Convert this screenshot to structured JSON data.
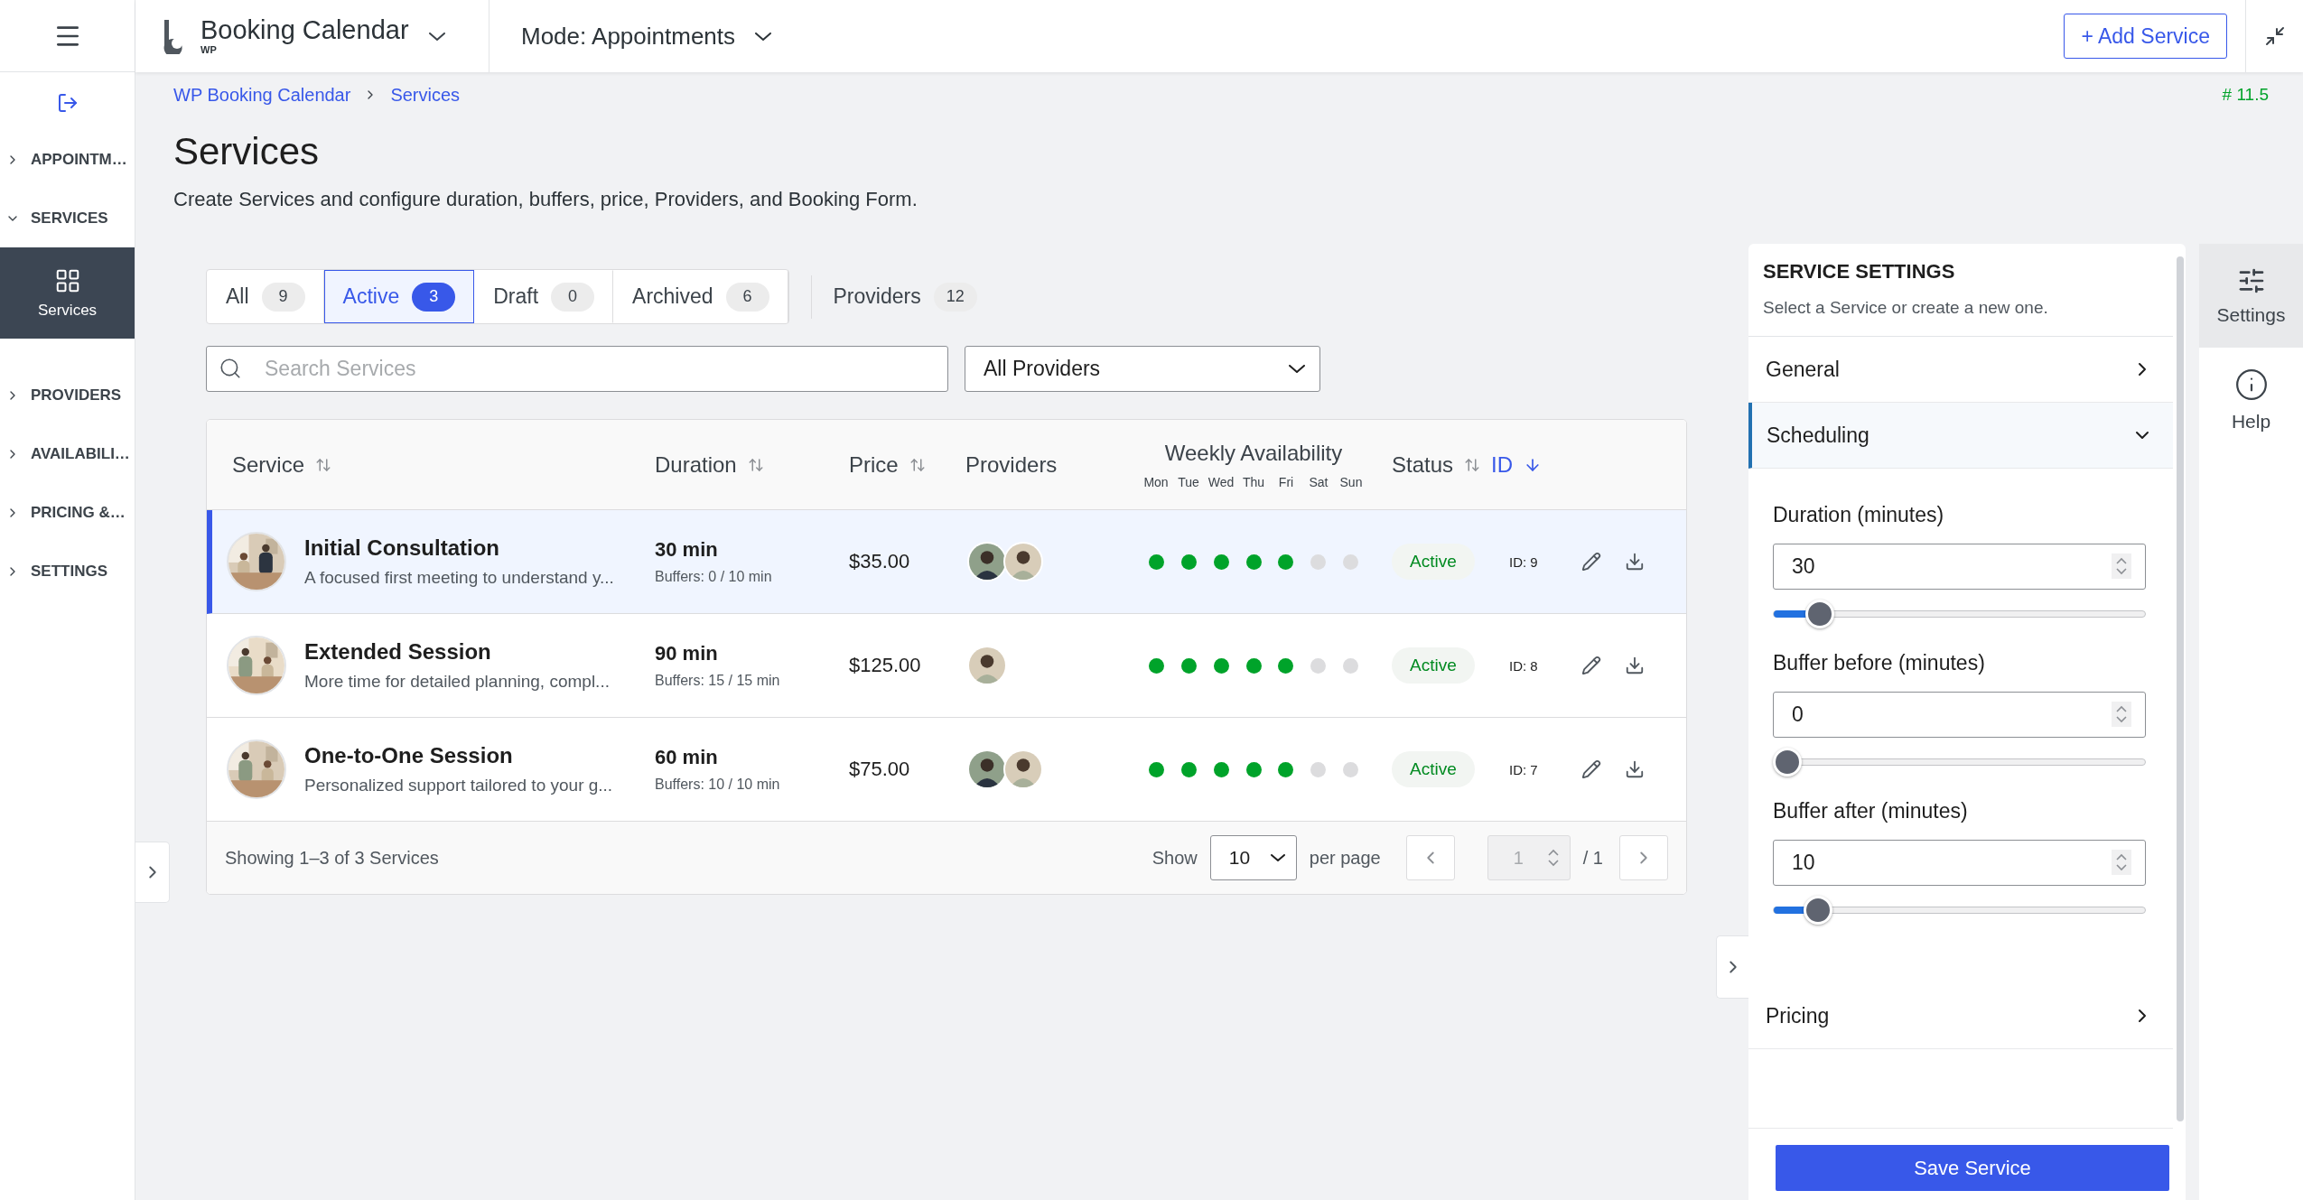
{
  "header": {
    "brand": "Booking Calendar",
    "brand_sub": "WP",
    "mode": "Mode: Appointments",
    "add_button": "+ Add Service"
  },
  "sidebar": {
    "items": [
      {
        "label": "APPOINTM…",
        "expanded": false
      },
      {
        "label": "SERVICES",
        "expanded": true,
        "children": [
          {
            "label": "Services",
            "selected": true
          }
        ]
      },
      {
        "label": "PROVIDERS",
        "expanded": false
      },
      {
        "label": "AVAILABILI…",
        "expanded": false
      },
      {
        "label": "PRICING &…",
        "expanded": false
      },
      {
        "label": "SETTINGS",
        "expanded": false
      }
    ]
  },
  "breadcrumb": [
    "WP Booking Calendar",
    "Services"
  ],
  "version": "# 11.5",
  "page": {
    "title": "Services",
    "subtitle": "Create Services and configure duration, buffers, price, Providers, and Booking Form."
  },
  "tabs": [
    {
      "label": "All",
      "count": "9",
      "selected": false
    },
    {
      "label": "Active",
      "count": "3",
      "selected": true
    },
    {
      "label": "Draft",
      "count": "0",
      "selected": false
    },
    {
      "label": "Archived",
      "count": "6",
      "selected": false
    }
  ],
  "providers_link": {
    "label": "Providers",
    "count": "12"
  },
  "search": {
    "placeholder": "Search Services"
  },
  "provider_filter": {
    "value": "All Providers"
  },
  "table": {
    "columns": [
      {
        "label": "Service",
        "sortable": true,
        "sorted": false
      },
      {
        "label": "Duration",
        "sortable": true,
        "sorted": false
      },
      {
        "label": "Price",
        "sortable": true,
        "sorted": false
      },
      {
        "label": "Providers",
        "sortable": false,
        "sorted": false
      },
      {
        "label": "Weekly Availability",
        "sortable": false,
        "sorted": false
      },
      {
        "label": "Status",
        "sortable": true,
        "sorted": false
      },
      {
        "label": "ID",
        "sortable": true,
        "sorted": true
      }
    ],
    "days": [
      "Mon",
      "Tue",
      "Wed",
      "Thu",
      "Fri",
      "Sat",
      "Sun"
    ],
    "rows": [
      {
        "selected": true,
        "name": "Initial Consultation",
        "description": "A focused first meeting to understand y...",
        "duration": "30 min",
        "buffers": "Buffers: 0 / 10 min",
        "price": "$35.00",
        "providers": [
          {
            "kind": "dark"
          },
          {
            "kind": "light"
          }
        ],
        "availability": [
          true,
          true,
          true,
          true,
          true,
          false,
          false
        ],
        "status": "Active",
        "id": "ID: 9"
      },
      {
        "selected": false,
        "name": "Extended Session",
        "description": "More time for detailed planning, compl...",
        "duration": "90 min",
        "buffers": "Buffers: 15 / 15 min",
        "price": "$125.00",
        "providers": [
          {
            "kind": "light"
          }
        ],
        "availability": [
          true,
          true,
          true,
          true,
          true,
          false,
          false
        ],
        "status": "Active",
        "id": "ID: 8"
      },
      {
        "selected": false,
        "name": "One-to-One Session",
        "description": "Personalized support tailored to your g...",
        "duration": "60 min",
        "buffers": "Buffers: 10 / 10 min",
        "price": "$75.00",
        "providers": [
          {
            "kind": "dark"
          },
          {
            "kind": "light"
          }
        ],
        "availability": [
          true,
          true,
          true,
          true,
          true,
          false,
          false
        ],
        "status": "Active",
        "id": "ID: 7"
      }
    ],
    "footer": {
      "summary": "Showing 1–3 of 3 Services",
      "show": "Show",
      "page_size": "10",
      "per_page": "per page",
      "page": "1",
      "of_pages": "/ 1"
    }
  },
  "panel": {
    "title": "SERVICE SETTINGS",
    "subtitle": "Select a Service or create a new one.",
    "sections": [
      {
        "title": "General",
        "expanded": false
      },
      {
        "title": "Scheduling",
        "expanded": true,
        "fields": [
          {
            "label": "Duration (minutes)",
            "value": "30",
            "level": 0.095
          },
          {
            "label": "Buffer before (minutes)",
            "value": "0",
            "level": 0
          },
          {
            "label": "Buffer after (minutes)",
            "value": "10",
            "level": 0.09
          }
        ]
      },
      {
        "title": "Pricing",
        "expanded": false
      }
    ],
    "save_button": "Save Service"
  },
  "rail": [
    {
      "label": "Settings",
      "kind": "settings",
      "selected": true
    },
    {
      "label": "Help",
      "kind": "help",
      "selected": false
    }
  ]
}
